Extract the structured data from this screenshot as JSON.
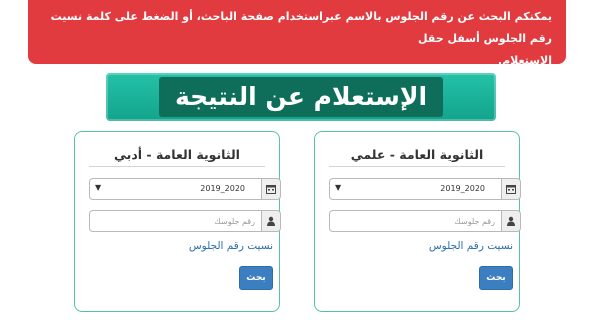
{
  "alert": {
    "line1": "يمكنكم البحث عن رقم الجلوس بالاسم عبراستخدام صفحة الباحث، أو الضغط على كلمة نسيت رقم الجلوس أسفل حقل",
    "line2": "الإستعلام."
  },
  "banner": {
    "title": "الإستعلام عن النتيجة"
  },
  "cards": {
    "literary": {
      "title": "الثانوية العامة - أدبي",
      "year_value": "2019_2020",
      "seat_placeholder": "رقم جلوسك",
      "forgot_label": "نسيت رقم الجلوس",
      "search_label": "بحث"
    },
    "science": {
      "title": "الثانوية العامة - علمي",
      "year_value": "2019_2020",
      "seat_placeholder": "رقم جلوسك",
      "forgot_label": "نسيت رقم الجلوس",
      "search_label": "بحث"
    }
  },
  "icons": {
    "year": "calendar-icon",
    "seat": "user-icon",
    "dropdown": "chevron-down-icon"
  },
  "colors": {
    "alert": "#e13a3f",
    "banner": "#1cb39b",
    "banner_inner": "#0e6e59",
    "card_border": "#55c3a1",
    "button": "#3c7fc1",
    "link": "#2a6fb0"
  }
}
